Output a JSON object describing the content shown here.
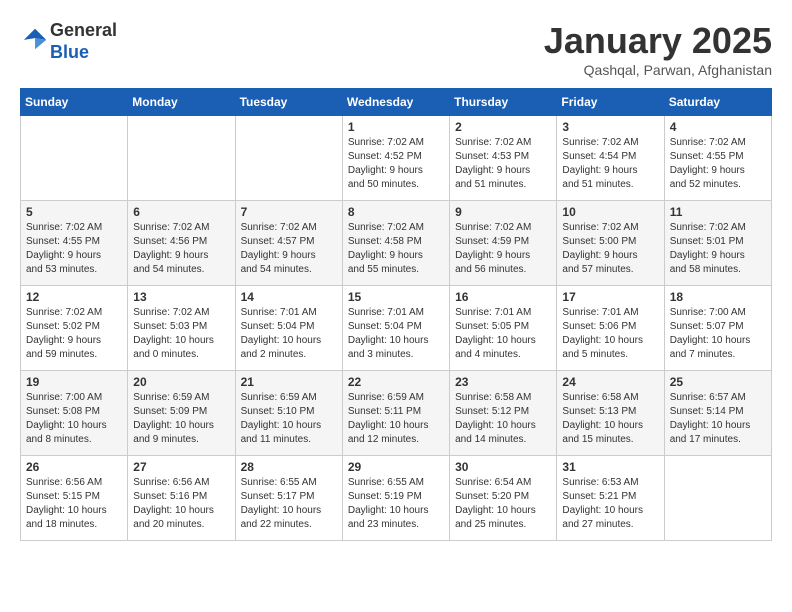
{
  "header": {
    "logo_line1": "General",
    "logo_line2": "Blue",
    "title": "January 2025",
    "subtitle": "Qashqal, Parwan, Afghanistan"
  },
  "weekdays": [
    "Sunday",
    "Monday",
    "Tuesday",
    "Wednesday",
    "Thursday",
    "Friday",
    "Saturday"
  ],
  "weeks": [
    [
      {
        "day": "",
        "info": ""
      },
      {
        "day": "",
        "info": ""
      },
      {
        "day": "",
        "info": ""
      },
      {
        "day": "1",
        "info": "Sunrise: 7:02 AM\nSunset: 4:52 PM\nDaylight: 9 hours\nand 50 minutes."
      },
      {
        "day": "2",
        "info": "Sunrise: 7:02 AM\nSunset: 4:53 PM\nDaylight: 9 hours\nand 51 minutes."
      },
      {
        "day": "3",
        "info": "Sunrise: 7:02 AM\nSunset: 4:54 PM\nDaylight: 9 hours\nand 51 minutes."
      },
      {
        "day": "4",
        "info": "Sunrise: 7:02 AM\nSunset: 4:55 PM\nDaylight: 9 hours\nand 52 minutes."
      }
    ],
    [
      {
        "day": "5",
        "info": "Sunrise: 7:02 AM\nSunset: 4:55 PM\nDaylight: 9 hours\nand 53 minutes."
      },
      {
        "day": "6",
        "info": "Sunrise: 7:02 AM\nSunset: 4:56 PM\nDaylight: 9 hours\nand 54 minutes."
      },
      {
        "day": "7",
        "info": "Sunrise: 7:02 AM\nSunset: 4:57 PM\nDaylight: 9 hours\nand 54 minutes."
      },
      {
        "day": "8",
        "info": "Sunrise: 7:02 AM\nSunset: 4:58 PM\nDaylight: 9 hours\nand 55 minutes."
      },
      {
        "day": "9",
        "info": "Sunrise: 7:02 AM\nSunset: 4:59 PM\nDaylight: 9 hours\nand 56 minutes."
      },
      {
        "day": "10",
        "info": "Sunrise: 7:02 AM\nSunset: 5:00 PM\nDaylight: 9 hours\nand 57 minutes."
      },
      {
        "day": "11",
        "info": "Sunrise: 7:02 AM\nSunset: 5:01 PM\nDaylight: 9 hours\nand 58 minutes."
      }
    ],
    [
      {
        "day": "12",
        "info": "Sunrise: 7:02 AM\nSunset: 5:02 PM\nDaylight: 9 hours\nand 59 minutes."
      },
      {
        "day": "13",
        "info": "Sunrise: 7:02 AM\nSunset: 5:03 PM\nDaylight: 10 hours\nand 0 minutes."
      },
      {
        "day": "14",
        "info": "Sunrise: 7:01 AM\nSunset: 5:04 PM\nDaylight: 10 hours\nand 2 minutes."
      },
      {
        "day": "15",
        "info": "Sunrise: 7:01 AM\nSunset: 5:04 PM\nDaylight: 10 hours\nand 3 minutes."
      },
      {
        "day": "16",
        "info": "Sunrise: 7:01 AM\nSunset: 5:05 PM\nDaylight: 10 hours\nand 4 minutes."
      },
      {
        "day": "17",
        "info": "Sunrise: 7:01 AM\nSunset: 5:06 PM\nDaylight: 10 hours\nand 5 minutes."
      },
      {
        "day": "18",
        "info": "Sunrise: 7:00 AM\nSunset: 5:07 PM\nDaylight: 10 hours\nand 7 minutes."
      }
    ],
    [
      {
        "day": "19",
        "info": "Sunrise: 7:00 AM\nSunset: 5:08 PM\nDaylight: 10 hours\nand 8 minutes."
      },
      {
        "day": "20",
        "info": "Sunrise: 6:59 AM\nSunset: 5:09 PM\nDaylight: 10 hours\nand 9 minutes."
      },
      {
        "day": "21",
        "info": "Sunrise: 6:59 AM\nSunset: 5:10 PM\nDaylight: 10 hours\nand 11 minutes."
      },
      {
        "day": "22",
        "info": "Sunrise: 6:59 AM\nSunset: 5:11 PM\nDaylight: 10 hours\nand 12 minutes."
      },
      {
        "day": "23",
        "info": "Sunrise: 6:58 AM\nSunset: 5:12 PM\nDaylight: 10 hours\nand 14 minutes."
      },
      {
        "day": "24",
        "info": "Sunrise: 6:58 AM\nSunset: 5:13 PM\nDaylight: 10 hours\nand 15 minutes."
      },
      {
        "day": "25",
        "info": "Sunrise: 6:57 AM\nSunset: 5:14 PM\nDaylight: 10 hours\nand 17 minutes."
      }
    ],
    [
      {
        "day": "26",
        "info": "Sunrise: 6:56 AM\nSunset: 5:15 PM\nDaylight: 10 hours\nand 18 minutes."
      },
      {
        "day": "27",
        "info": "Sunrise: 6:56 AM\nSunset: 5:16 PM\nDaylight: 10 hours\nand 20 minutes."
      },
      {
        "day": "28",
        "info": "Sunrise: 6:55 AM\nSunset: 5:17 PM\nDaylight: 10 hours\nand 22 minutes."
      },
      {
        "day": "29",
        "info": "Sunrise: 6:55 AM\nSunset: 5:19 PM\nDaylight: 10 hours\nand 23 minutes."
      },
      {
        "day": "30",
        "info": "Sunrise: 6:54 AM\nSunset: 5:20 PM\nDaylight: 10 hours\nand 25 minutes."
      },
      {
        "day": "31",
        "info": "Sunrise: 6:53 AM\nSunset: 5:21 PM\nDaylight: 10 hours\nand 27 minutes."
      },
      {
        "day": "",
        "info": ""
      }
    ]
  ]
}
